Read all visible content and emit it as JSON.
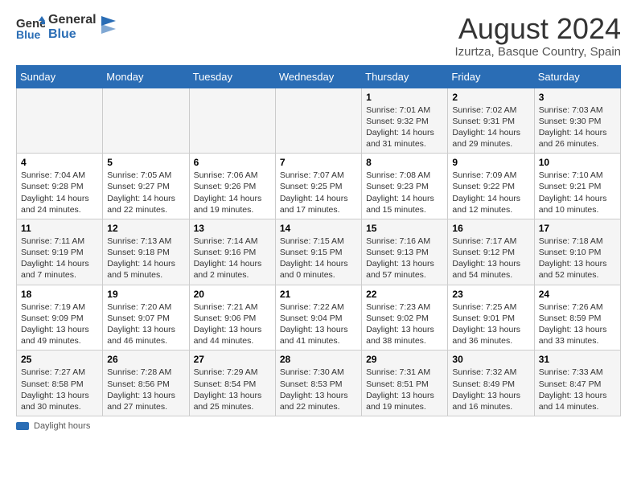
{
  "header": {
    "logo_line1": "General",
    "logo_line2": "Blue",
    "month_year": "August 2024",
    "location": "Izurtza, Basque Country, Spain"
  },
  "days_of_week": [
    "Sunday",
    "Monday",
    "Tuesday",
    "Wednesday",
    "Thursday",
    "Friday",
    "Saturday"
  ],
  "weeks": [
    [
      {
        "day": "",
        "info": ""
      },
      {
        "day": "",
        "info": ""
      },
      {
        "day": "",
        "info": ""
      },
      {
        "day": "",
        "info": ""
      },
      {
        "day": "1",
        "info": "Sunrise: 7:01 AM\nSunset: 9:32 PM\nDaylight: 14 hours and 31 minutes."
      },
      {
        "day": "2",
        "info": "Sunrise: 7:02 AM\nSunset: 9:31 PM\nDaylight: 14 hours and 29 minutes."
      },
      {
        "day": "3",
        "info": "Sunrise: 7:03 AM\nSunset: 9:30 PM\nDaylight: 14 hours and 26 minutes."
      }
    ],
    [
      {
        "day": "4",
        "info": "Sunrise: 7:04 AM\nSunset: 9:28 PM\nDaylight: 14 hours and 24 minutes."
      },
      {
        "day": "5",
        "info": "Sunrise: 7:05 AM\nSunset: 9:27 PM\nDaylight: 14 hours and 22 minutes."
      },
      {
        "day": "6",
        "info": "Sunrise: 7:06 AM\nSunset: 9:26 PM\nDaylight: 14 hours and 19 minutes."
      },
      {
        "day": "7",
        "info": "Sunrise: 7:07 AM\nSunset: 9:25 PM\nDaylight: 14 hours and 17 minutes."
      },
      {
        "day": "8",
        "info": "Sunrise: 7:08 AM\nSunset: 9:23 PM\nDaylight: 14 hours and 15 minutes."
      },
      {
        "day": "9",
        "info": "Sunrise: 7:09 AM\nSunset: 9:22 PM\nDaylight: 14 hours and 12 minutes."
      },
      {
        "day": "10",
        "info": "Sunrise: 7:10 AM\nSunset: 9:21 PM\nDaylight: 14 hours and 10 minutes."
      }
    ],
    [
      {
        "day": "11",
        "info": "Sunrise: 7:11 AM\nSunset: 9:19 PM\nDaylight: 14 hours and 7 minutes."
      },
      {
        "day": "12",
        "info": "Sunrise: 7:13 AM\nSunset: 9:18 PM\nDaylight: 14 hours and 5 minutes."
      },
      {
        "day": "13",
        "info": "Sunrise: 7:14 AM\nSunset: 9:16 PM\nDaylight: 14 hours and 2 minutes."
      },
      {
        "day": "14",
        "info": "Sunrise: 7:15 AM\nSunset: 9:15 PM\nDaylight: 14 hours and 0 minutes."
      },
      {
        "day": "15",
        "info": "Sunrise: 7:16 AM\nSunset: 9:13 PM\nDaylight: 13 hours and 57 minutes."
      },
      {
        "day": "16",
        "info": "Sunrise: 7:17 AM\nSunset: 9:12 PM\nDaylight: 13 hours and 54 minutes."
      },
      {
        "day": "17",
        "info": "Sunrise: 7:18 AM\nSunset: 9:10 PM\nDaylight: 13 hours and 52 minutes."
      }
    ],
    [
      {
        "day": "18",
        "info": "Sunrise: 7:19 AM\nSunset: 9:09 PM\nDaylight: 13 hours and 49 minutes."
      },
      {
        "day": "19",
        "info": "Sunrise: 7:20 AM\nSunset: 9:07 PM\nDaylight: 13 hours and 46 minutes."
      },
      {
        "day": "20",
        "info": "Sunrise: 7:21 AM\nSunset: 9:06 PM\nDaylight: 13 hours and 44 minutes."
      },
      {
        "day": "21",
        "info": "Sunrise: 7:22 AM\nSunset: 9:04 PM\nDaylight: 13 hours and 41 minutes."
      },
      {
        "day": "22",
        "info": "Sunrise: 7:23 AM\nSunset: 9:02 PM\nDaylight: 13 hours and 38 minutes."
      },
      {
        "day": "23",
        "info": "Sunrise: 7:25 AM\nSunset: 9:01 PM\nDaylight: 13 hours and 36 minutes."
      },
      {
        "day": "24",
        "info": "Sunrise: 7:26 AM\nSunset: 8:59 PM\nDaylight: 13 hours and 33 minutes."
      }
    ],
    [
      {
        "day": "25",
        "info": "Sunrise: 7:27 AM\nSunset: 8:58 PM\nDaylight: 13 hours and 30 minutes."
      },
      {
        "day": "26",
        "info": "Sunrise: 7:28 AM\nSunset: 8:56 PM\nDaylight: 13 hours and 27 minutes."
      },
      {
        "day": "27",
        "info": "Sunrise: 7:29 AM\nSunset: 8:54 PM\nDaylight: 13 hours and 25 minutes."
      },
      {
        "day": "28",
        "info": "Sunrise: 7:30 AM\nSunset: 8:53 PM\nDaylight: 13 hours and 22 minutes."
      },
      {
        "day": "29",
        "info": "Sunrise: 7:31 AM\nSunset: 8:51 PM\nDaylight: 13 hours and 19 minutes."
      },
      {
        "day": "30",
        "info": "Sunrise: 7:32 AM\nSunset: 8:49 PM\nDaylight: 13 hours and 16 minutes."
      },
      {
        "day": "31",
        "info": "Sunrise: 7:33 AM\nSunset: 8:47 PM\nDaylight: 13 hours and 14 minutes."
      }
    ]
  ],
  "footer": {
    "label": "Daylight hours"
  }
}
